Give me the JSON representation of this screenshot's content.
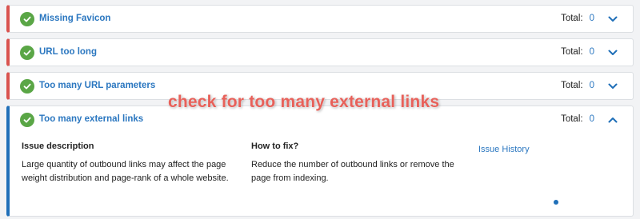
{
  "issues": [
    {
      "title": "Missing Favicon",
      "total_label": "Total:",
      "total": "0"
    },
    {
      "title": "URL too long",
      "total_label": "Total:",
      "total": "0"
    },
    {
      "title": "Too many URL parameters",
      "total_label": "Total:",
      "total": "0"
    },
    {
      "title": "Too many external links",
      "total_label": "Total:",
      "total": "0"
    }
  ],
  "expanded": {
    "description_heading": "Issue description",
    "description_text": "Large quantity of outbound links may affect the page weight distribution and page-rank of a whole website.",
    "fix_heading": "How to fix?",
    "fix_text": "Reduce the number of outbound links or remove the page from indexing.",
    "history_link": "Issue History"
  },
  "overlay_caption": "check for too many external links",
  "colors": {
    "error_border": "#d9534f",
    "active_border": "#1f6fb8",
    "success_check": "#5aa646",
    "link_blue": "#2b77c0",
    "caption_red": "#e8615a"
  }
}
